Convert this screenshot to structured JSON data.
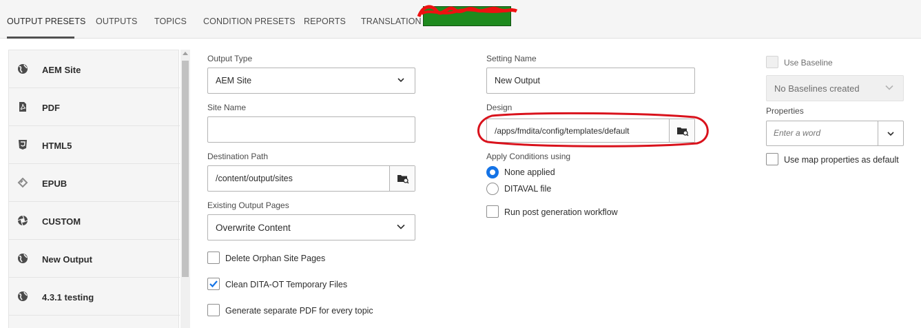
{
  "tabs": [
    "OUTPUT PRESETS",
    "OUTPUTS",
    "TOPICS",
    "CONDITION PRESETS",
    "REPORTS",
    "TRANSLATION"
  ],
  "active_tab": "OUTPUT PRESETS",
  "sidebar": {
    "items": [
      {
        "label": "AEM Site",
        "icon": "globe-icon"
      },
      {
        "label": "PDF",
        "icon": "pdf-icon"
      },
      {
        "label": "HTML5",
        "icon": "html5-icon"
      },
      {
        "label": "EPUB",
        "icon": "epub-icon"
      },
      {
        "label": "CUSTOM",
        "icon": "aperture-icon"
      },
      {
        "label": "New Output",
        "icon": "globe-icon"
      },
      {
        "label": "4.3.1 testing",
        "icon": "globe-icon"
      }
    ]
  },
  "form": {
    "output_type": {
      "label": "Output Type",
      "value": "AEM Site"
    },
    "site_name": {
      "label": "Site Name",
      "value": ""
    },
    "destination_path": {
      "label": "Destination Path",
      "value": "/content/output/sites"
    },
    "existing_output_pages": {
      "label": "Existing Output Pages",
      "value": "Overwrite Content"
    },
    "delete_orphan": {
      "label": "Delete Orphan Site Pages",
      "checked": false
    },
    "clean_temp": {
      "label": "Clean DITA-OT Temporary Files",
      "checked": true
    },
    "separate_pdf": {
      "label": "Generate separate PDF for every topic",
      "checked": false
    },
    "setting_name": {
      "label": "Setting Name",
      "value": "New Output"
    },
    "design": {
      "label": "Design",
      "value": "/apps/fmdita/config/templates/default"
    },
    "apply_conditions": {
      "label": "Apply Conditions using",
      "options": [
        "None applied",
        "DITAVAL file"
      ],
      "selected": "None applied"
    },
    "run_post_workflow": {
      "label": "Run post generation workflow",
      "checked": false
    },
    "use_baseline": {
      "label": "Use Baseline",
      "checked": false,
      "disabled": true
    },
    "baseline_select": {
      "value": "No Baselines created",
      "disabled": true
    },
    "properties": {
      "label": "Properties",
      "placeholder": "Enter a word"
    },
    "use_map_properties": {
      "label": "Use map properties as default",
      "checked": false
    }
  },
  "colors": {
    "accent": "#1473e6",
    "annotation": "#d9121c",
    "redaction": "#1e8a1e"
  }
}
